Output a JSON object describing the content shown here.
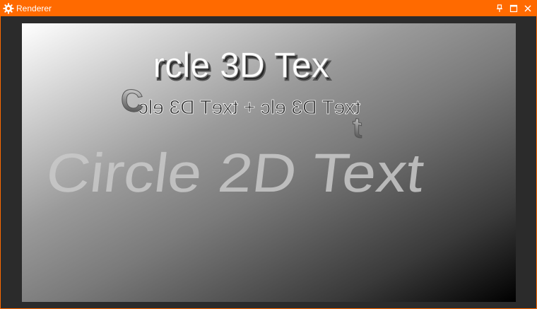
{
  "window": {
    "title": "Renderer",
    "accent": "#ff6a00",
    "icons": {
      "app": "gear-icon",
      "pin": "pin-icon",
      "maximize": "maximize-icon",
      "close": "close-icon"
    }
  },
  "scene": {
    "text3d": {
      "front_text": "rcle 3D Tex",
      "back_text": "txeT D3 elc + txeT D3 elc",
      "left_fragment": "C",
      "right_fragment": "t"
    },
    "text2d": {
      "text": "Circle 2D Text"
    }
  }
}
